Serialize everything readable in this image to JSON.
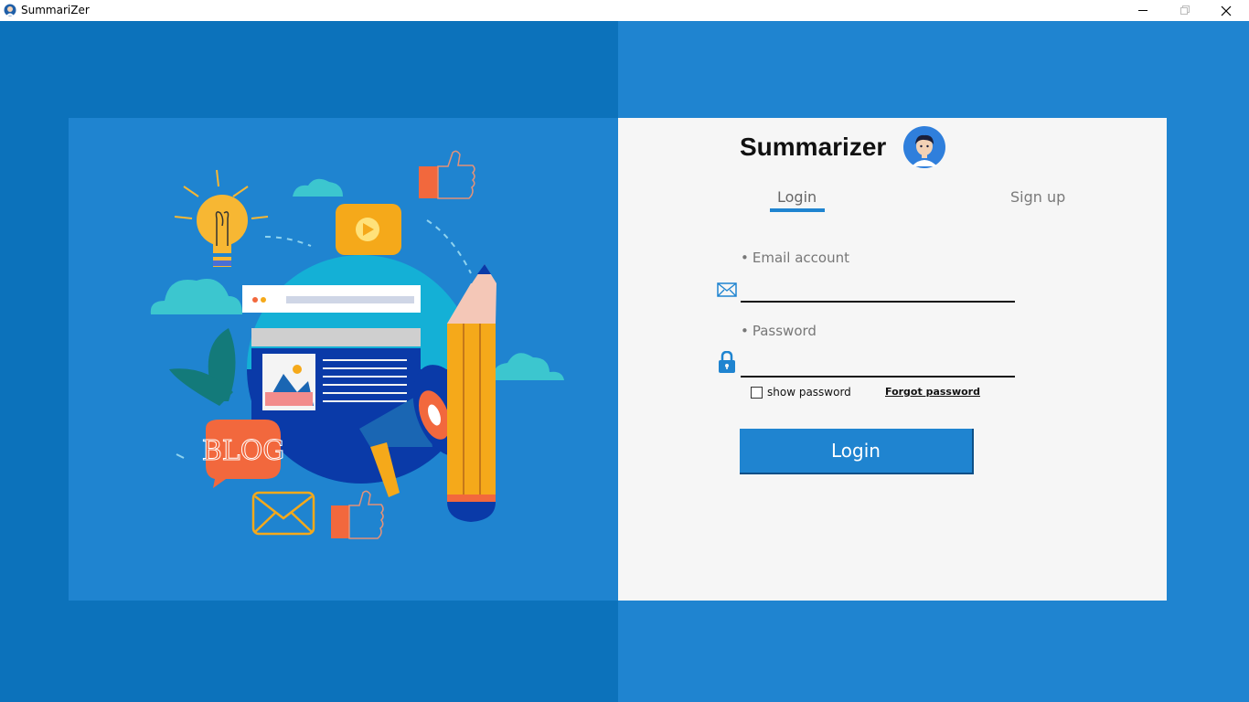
{
  "window": {
    "title": "SummariZer",
    "controls": [
      "minimize",
      "maximize",
      "close"
    ]
  },
  "illustration": {
    "badge_text": "BLOG"
  },
  "card": {
    "brand": "Summarizer",
    "tabs": [
      {
        "label": "Login",
        "active": true
      },
      {
        "label": "Sign up",
        "active": false
      }
    ],
    "email": {
      "label": "Email account",
      "value": "",
      "placeholder": ""
    },
    "password": {
      "label": "Password",
      "value": "",
      "placeholder": ""
    },
    "show_password": {
      "label": "show password",
      "checked": false
    },
    "forgot_password": "Forgot password",
    "login_button": "Login",
    "bullet": "•"
  },
  "colors": {
    "accent": "#1f84d0",
    "dark_blue": "#0c72bb",
    "card_bg": "#f6f6f6"
  }
}
